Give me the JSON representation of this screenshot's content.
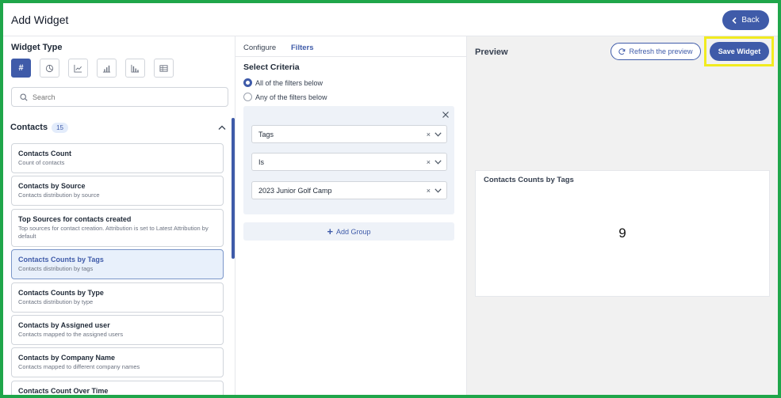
{
  "header": {
    "title": "Add Widget",
    "back_label": "Back"
  },
  "left": {
    "widget_type_label": "Widget Type",
    "types": [
      {
        "name": "number",
        "active": true
      },
      {
        "name": "pie"
      },
      {
        "name": "line"
      },
      {
        "name": "bar"
      },
      {
        "name": "histogram"
      },
      {
        "name": "table"
      }
    ],
    "search_placeholder": "Search",
    "group": {
      "name": "Contacts",
      "count": "15"
    },
    "widgets": [
      {
        "title": "Contacts Count",
        "desc": "Count of contacts"
      },
      {
        "title": "Contacts by Source",
        "desc": "Contacts distribution by source"
      },
      {
        "title": "Top Sources for contacts created",
        "desc": "Top sources for contact creation. Attribution is set to Latest Attribution by default"
      },
      {
        "title": "Contacts Counts by Tags",
        "desc": "Contacts distribution by tags",
        "selected": true
      },
      {
        "title": "Contacts Counts by Type",
        "desc": "Contacts distribution by type"
      },
      {
        "title": "Contacts by Assigned user",
        "desc": "Contacts mapped to the assigned users"
      },
      {
        "title": "Contacts by Company Name",
        "desc": "Contacts mapped to different company names"
      },
      {
        "title": "Contacts Count Over Time",
        "desc": ""
      }
    ]
  },
  "middle": {
    "tabs": [
      "Configure",
      "Filters"
    ],
    "active_tab": "Filters",
    "criteria_title": "Select Criteria",
    "radio_all": "All of the filters below",
    "radio_any": "Any of the filters below",
    "filter_field": "Tags",
    "filter_operator": "Is",
    "filter_value": "2023 Junior Golf Camp",
    "clear_glyph": "×",
    "add_group_label": "Add Group"
  },
  "right": {
    "preview_label": "Preview",
    "refresh_label": "Refresh the preview",
    "save_label": "Save Widget",
    "card_title": "Contacts Counts by Tags",
    "card_value": "9"
  },
  "colors": {
    "primary": "#3f5ba9",
    "highlight": "#f1eb1f",
    "frame": "#1fa64a",
    "selected_bg": "#e8f0fb"
  }
}
